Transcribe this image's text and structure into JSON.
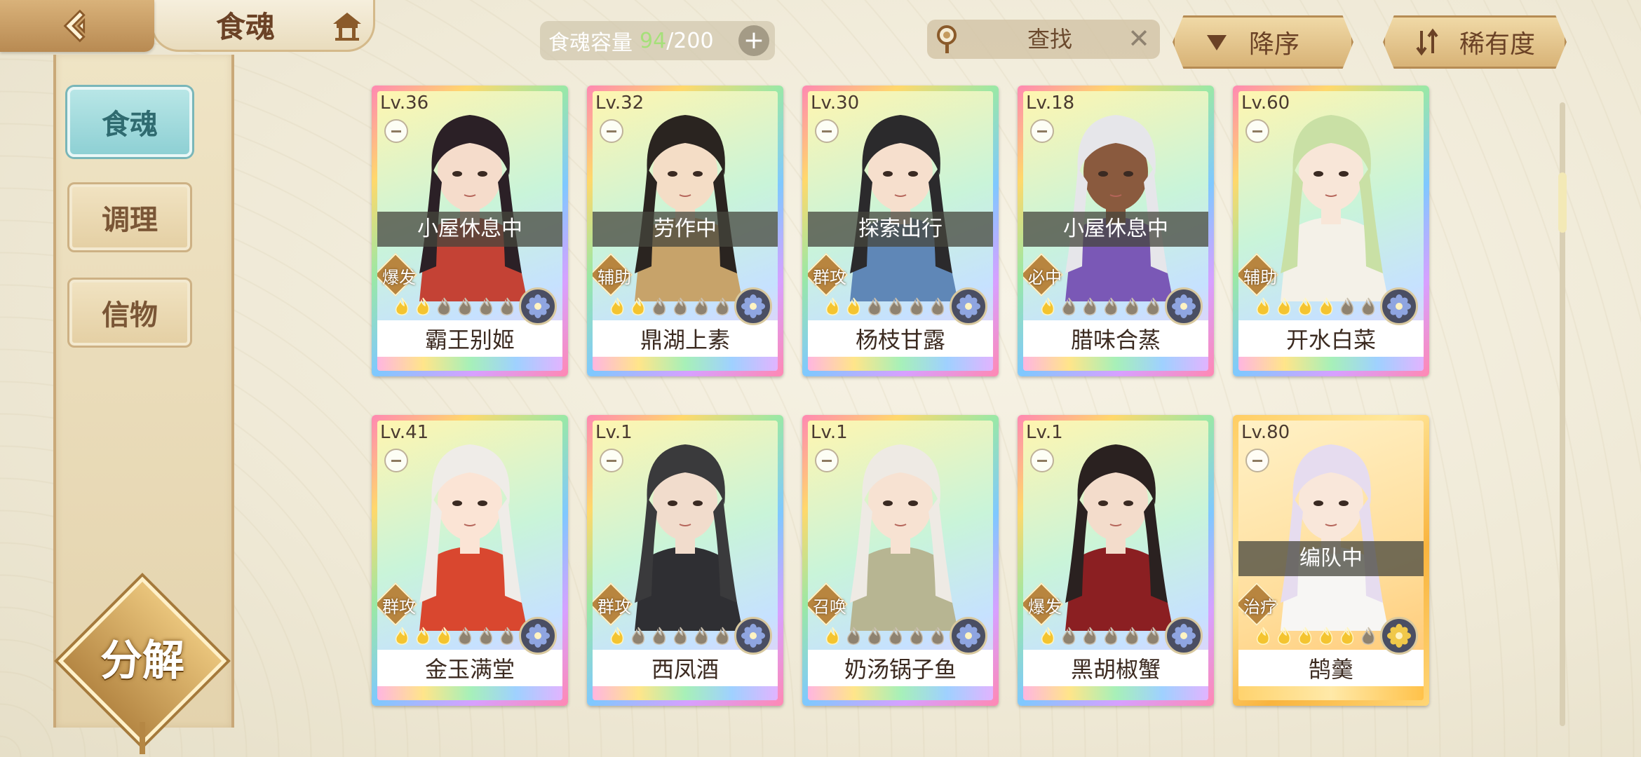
{
  "header": {
    "title": "食魂",
    "capacity_label": "食魂容量",
    "capacity_current": "94",
    "capacity_max": "/200",
    "search_placeholder": "查找",
    "sort_order_label": "降序",
    "sort_field_label": "稀有度"
  },
  "sidebar": {
    "tabs": [
      {
        "label": "食魂",
        "active": true
      },
      {
        "label": "调理",
        "active": false
      },
      {
        "label": "信物",
        "active": false
      }
    ],
    "decompose_label": "分解"
  },
  "colors": {
    "accent_teal": "#8ed0d4",
    "brown": "#6b4226",
    "gold": "#b8853f"
  },
  "cards": [
    {
      "level": "Lv.36",
      "status": "小屋休息中",
      "role": "爆发",
      "stars": 2,
      "name": "霸王别姬",
      "frame": "rainbow",
      "hair": "#2b2026",
      "skin": "#f5dccb",
      "robe": "#c44235"
    },
    {
      "level": "Lv.32",
      "status": "劳作中",
      "role": "辅助",
      "stars": 2,
      "name": "鼎湖上素",
      "frame": "rainbow",
      "hair": "#2a2420",
      "skin": "#f4ddc6",
      "robe": "#c7a36a"
    },
    {
      "level": "Lv.30",
      "status": "探索出行",
      "role": "群攻",
      "stars": 2,
      "name": "杨枝甘露",
      "frame": "rainbow",
      "hair": "#2b2a2c",
      "skin": "#f6dfcd",
      "robe": "#5f87b7"
    },
    {
      "level": "Lv.18",
      "status": "小屋休息中",
      "role": "必中",
      "stars": 1,
      "name": "腊味合蒸",
      "frame": "rainbow",
      "hair": "#e6e6ea",
      "skin": "#8a5a3e",
      "robe": "#7a58b6"
    },
    {
      "level": "Lv.60",
      "status": "",
      "role": "辅助",
      "stars": 4,
      "name": "开水白菜",
      "frame": "rainbow",
      "hair": "#c9e0a5",
      "skin": "#f8e6d8",
      "robe": "#f4f1e8"
    },
    {
      "level": "Lv.41",
      "status": "",
      "role": "群攻",
      "stars": 3,
      "name": "金玉满堂",
      "frame": "rainbow",
      "hair": "#efece8",
      "skin": "#fbe4d5",
      "robe": "#d9472f"
    },
    {
      "level": "Lv.1",
      "status": "",
      "role": "群攻",
      "stars": 1,
      "name": "西凤酒",
      "frame": "rainbow",
      "hair": "#3a3a3c",
      "skin": "#f1dccc",
      "robe": "#2f2f33"
    },
    {
      "level": "Lv.1",
      "status": "",
      "role": "召唤",
      "stars": 1,
      "name": "奶汤锅子鱼",
      "frame": "rainbow",
      "hair": "#eeeae4",
      "skin": "#f7e2d2",
      "robe": "#b7b592"
    },
    {
      "level": "Lv.1",
      "status": "",
      "role": "爆发",
      "stars": 1,
      "name": "黑胡椒蟹",
      "frame": "rainbow",
      "hair": "#2a2120",
      "skin": "#f3dccb",
      "robe": "#8b1f22"
    },
    {
      "level": "Lv.80",
      "status": "编队中",
      "role": "治疗",
      "stars": 5,
      "name": "鹄羹",
      "frame": "gold",
      "hair": "#e6dcef",
      "skin": "#f9e7da",
      "robe": "#f7f6f4"
    }
  ]
}
